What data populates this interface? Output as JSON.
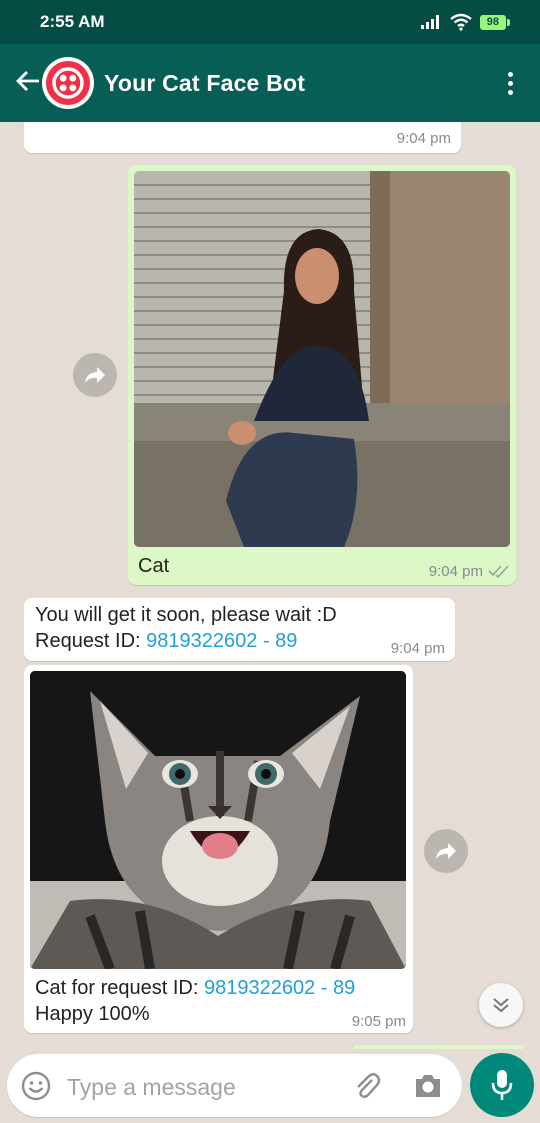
{
  "status_bar": {
    "time": "2:55 AM",
    "battery": "98"
  },
  "header": {
    "title": "Your Cat Face Bot"
  },
  "messages": [
    {
      "time": "9:04 pm"
    },
    {
      "caption": "Cat",
      "time": "9:04 pm"
    },
    {
      "line1": "You will get it soon, please wait :D",
      "line2_prefix": "Request ID: ",
      "request_id": "9819322602 - 89",
      "time": "9:04 pm"
    },
    {
      "line1_prefix": "Cat for request ID: ",
      "request_id": "9819322602 - 89",
      "line2": "Happy 100%",
      "time": "9:05 pm"
    }
  ],
  "composer": {
    "placeholder": "Type a message"
  },
  "colors": {
    "header": "#075e54",
    "status_bar": "#054d44",
    "outgoing": "#dcf8c6",
    "incoming": "#ffffff",
    "link": "#1ea0d8",
    "fab": "#00897b"
  },
  "icons": [
    "back-arrow-icon",
    "twilio-logo-icon",
    "more-vert-icon",
    "forward-icon",
    "double-check-icon",
    "chevron-double-down-icon",
    "emoji-icon",
    "attach-icon",
    "camera-icon",
    "mic-icon"
  ]
}
